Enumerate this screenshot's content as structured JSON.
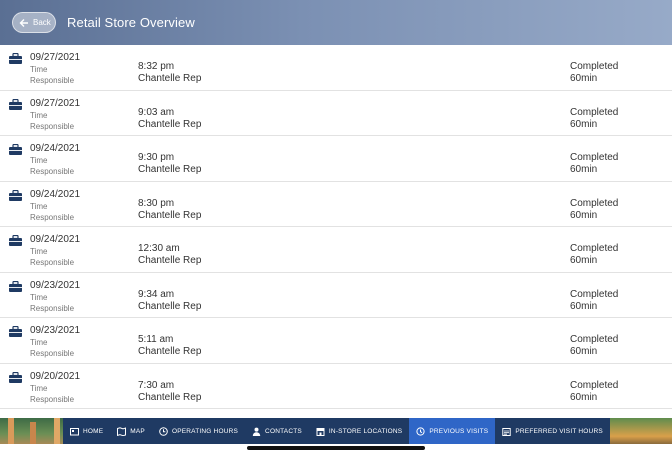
{
  "header": {
    "back_label": "Back",
    "title": "Retail Store Overview"
  },
  "labels": {
    "time": "Time",
    "responsible": "Responsible"
  },
  "visits": [
    {
      "date": "09/27/2021",
      "time": "8:32 pm",
      "rep": "Chantelle Rep",
      "status": "Completed",
      "duration": "60min"
    },
    {
      "date": "09/27/2021",
      "time": "9:03 am",
      "rep": "Chantelle Rep",
      "status": "Completed",
      "duration": "60min"
    },
    {
      "date": "09/24/2021",
      "time": "9:30 pm",
      "rep": "Chantelle Rep",
      "status": "Completed",
      "duration": "60min"
    },
    {
      "date": "09/24/2021",
      "time": "8:30 pm",
      "rep": "Chantelle Rep",
      "status": "Completed",
      "duration": "60min"
    },
    {
      "date": "09/24/2021",
      "time": "12:30 am",
      "rep": "Chantelle Rep",
      "status": "Completed",
      "duration": "60min"
    },
    {
      "date": "09/23/2021",
      "time": "9:34 am",
      "rep": "Chantelle Rep",
      "status": "Completed",
      "duration": "60min"
    },
    {
      "date": "09/23/2021",
      "time": "5:11 am",
      "rep": "Chantelle Rep",
      "status": "Completed",
      "duration": "60min"
    },
    {
      "date": "09/20/2021",
      "time": "7:30 am",
      "rep": "Chantelle Rep",
      "status": "Completed",
      "duration": "60min"
    }
  ],
  "tabs": [
    {
      "label": "HOME",
      "icon": "home-icon"
    },
    {
      "label": "MAP",
      "icon": "map-icon"
    },
    {
      "label": "OPERATING HOURS",
      "icon": "clock-icon"
    },
    {
      "label": "CONTACTS",
      "icon": "person-icon"
    },
    {
      "label": "IN-STORE LOCATIONS",
      "icon": "store-icon"
    },
    {
      "label": "PREVIOUS VISITS",
      "icon": "history-icon",
      "active": true
    },
    {
      "label": "PREFERRED VISIT HOURS",
      "icon": "calendar-icon"
    }
  ],
  "colors": {
    "header": "#6f84a9",
    "tabbar": "#1f3a63",
    "active_tab": "#2f66c7",
    "briefcase": "#1f3a63"
  }
}
